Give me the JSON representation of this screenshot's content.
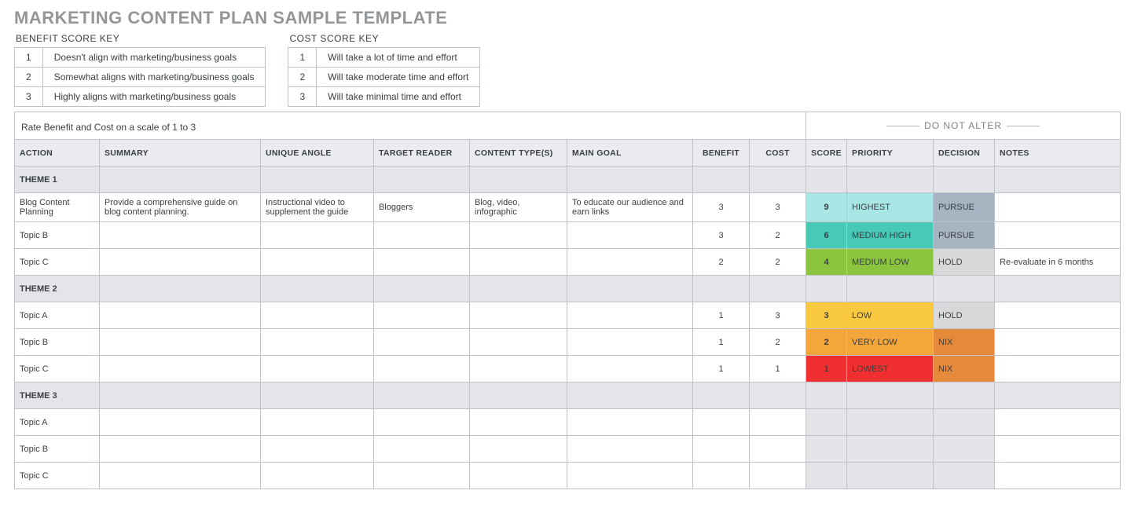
{
  "title": "MARKETING CONTENT PLAN SAMPLE TEMPLATE",
  "benefit_key": {
    "title": "BENEFIT SCORE KEY",
    "rows": [
      {
        "n": "1",
        "t": "Doesn't align with marketing/business goals"
      },
      {
        "n": "2",
        "t": "Somewhat aligns with marketing/business goals"
      },
      {
        "n": "3",
        "t": "Highly aligns with marketing/business goals"
      }
    ]
  },
  "cost_key": {
    "title": "COST SCORE KEY",
    "rows": [
      {
        "n": "1",
        "t": "Will take a lot of time and effort"
      },
      {
        "n": "2",
        "t": "Will take moderate time and effort"
      },
      {
        "n": "3",
        "t": "Will take minimal time and effort"
      }
    ]
  },
  "rate_line": "Rate Benefit and Cost on a scale of 1 to 3",
  "do_not_alter": "DO NOT ALTER",
  "headers": {
    "action": "ACTION",
    "summary": "SUMMARY",
    "unique": "UNIQUE ANGLE",
    "target": "TARGET READER",
    "content": "CONTENT TYPE(S)",
    "goal": "MAIN GOAL",
    "benefit": "BENEFIT",
    "cost": "COST",
    "score": "SCORE",
    "priority": "PRIORITY",
    "decision": "DECISION",
    "notes": "NOTES"
  },
  "themes": {
    "1": "THEME 1",
    "2": "THEME 2",
    "3": "THEME 3"
  },
  "rows": {
    "t1r1": {
      "action": "Blog Content Planning",
      "summary": "Provide a comprehensive guide on blog content planning.",
      "unique": "Instructional video to supplement the guide",
      "target": "Bloggers",
      "content": "Blog, video, infographic",
      "goal": "To educate our audience and earn links",
      "benefit": "3",
      "cost": "3",
      "score": "9",
      "priority": "HIGHEST",
      "decision": "PURSUE",
      "notes": ""
    },
    "t1r2": {
      "action": "Topic B",
      "summary": "",
      "unique": "",
      "target": "",
      "content": "",
      "goal": "",
      "benefit": "3",
      "cost": "2",
      "score": "6",
      "priority": "MEDIUM HIGH",
      "decision": "PURSUE",
      "notes": ""
    },
    "t1r3": {
      "action": "Topic C",
      "summary": "",
      "unique": "",
      "target": "",
      "content": "",
      "goal": "",
      "benefit": "2",
      "cost": "2",
      "score": "4",
      "priority": "MEDIUM LOW",
      "decision": "HOLD",
      "notes": "Re-evaluate in 6 months"
    },
    "t2r1": {
      "action": "Topic A",
      "summary": "",
      "unique": "",
      "target": "",
      "content": "",
      "goal": "",
      "benefit": "1",
      "cost": "3",
      "score": "3",
      "priority": "LOW",
      "decision": "HOLD",
      "notes": ""
    },
    "t2r2": {
      "action": "Topic B",
      "summary": "",
      "unique": "",
      "target": "",
      "content": "",
      "goal": "",
      "benefit": "1",
      "cost": "2",
      "score": "2",
      "priority": "VERY LOW",
      "decision": "NIX",
      "notes": ""
    },
    "t2r3": {
      "action": "Topic C",
      "summary": "",
      "unique": "",
      "target": "",
      "content": "",
      "goal": "",
      "benefit": "1",
      "cost": "1",
      "score": "1",
      "priority": "LOWEST",
      "decision": "NIX",
      "notes": ""
    },
    "t3r1": {
      "action": "Topic A"
    },
    "t3r2": {
      "action": "Topic B"
    },
    "t3r3": {
      "action": "Topic C"
    }
  }
}
